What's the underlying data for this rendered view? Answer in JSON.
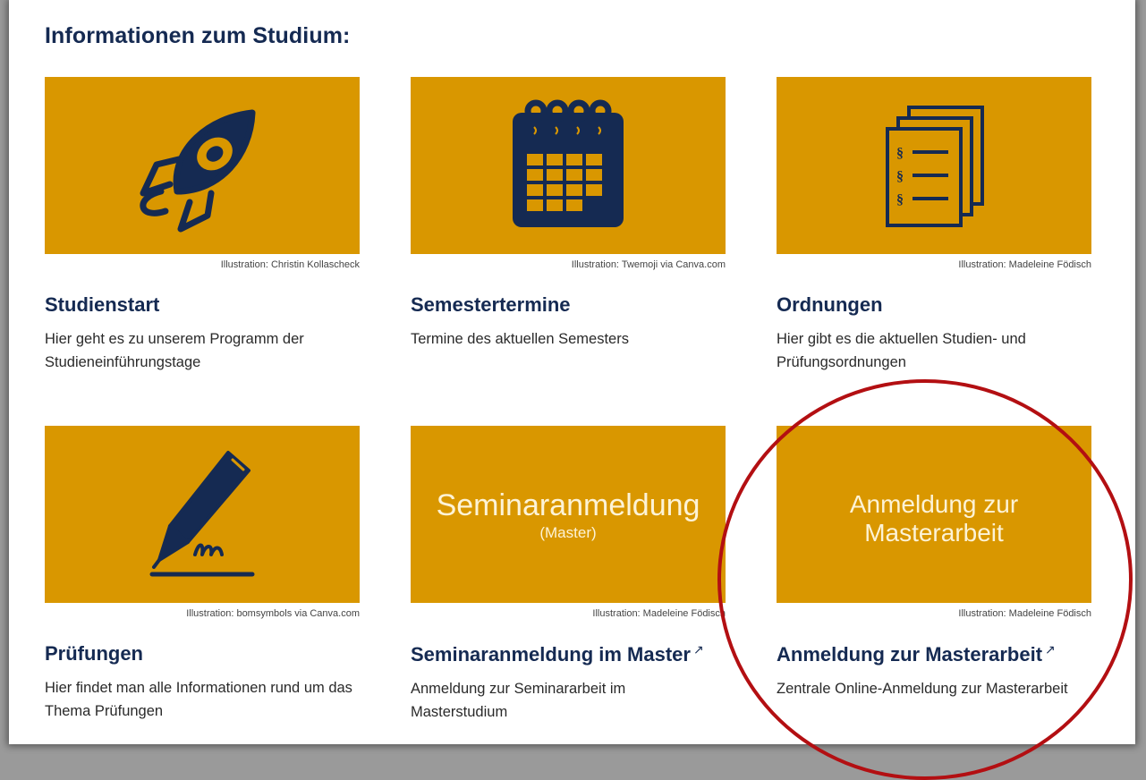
{
  "section": {
    "heading": "Informationen zum Studium:"
  },
  "cards": [
    {
      "title": "Studienstart",
      "credit": "Illustration: Christin Kollascheck",
      "description": "Hier geht es zu unserem Programm der Studieneinführungstage",
      "icon": "rocket-icon"
    },
    {
      "title": "Semestertermine",
      "credit": "Illustration: Twemoji via Canva.com",
      "description": "Termine des aktuellen Semesters",
      "icon": "calendar-icon"
    },
    {
      "title": "Ordnungen",
      "credit": "Illustration: Madeleine Födisch",
      "description": "Hier gibt es die aktuellen Studien- und Prüfungsordnungen",
      "icon": "documents-icon"
    },
    {
      "title": "Prüfungen",
      "credit": "Illustration: bomsymbols via Canva.com",
      "description": "Hier findet man alle Informationen rund um das Thema Prüfungen",
      "icon": "fountain-pen-icon"
    },
    {
      "title": "Seminaranmeldung im Master",
      "credit": "Illustration: Madeleine Födisch",
      "description": "Anmeldung zur Seminararbeit im Masterstudium",
      "tile_text": "Seminaranmeldung",
      "tile_subtext": "(Master)",
      "external": "↗"
    },
    {
      "title": "Anmeldung zur Masterarbeit",
      "credit": "Illustration: Madeleine Födisch",
      "description": "Zentrale Online-Anmeldung zur Masterarbeit",
      "tile_text_line1": "Anmeldung zur",
      "tile_text_line2": "Masterarbeit",
      "external": "↗"
    }
  ],
  "colors": {
    "tile": "#d99700",
    "navy": "#152a52",
    "annotation": "#b30f12"
  }
}
